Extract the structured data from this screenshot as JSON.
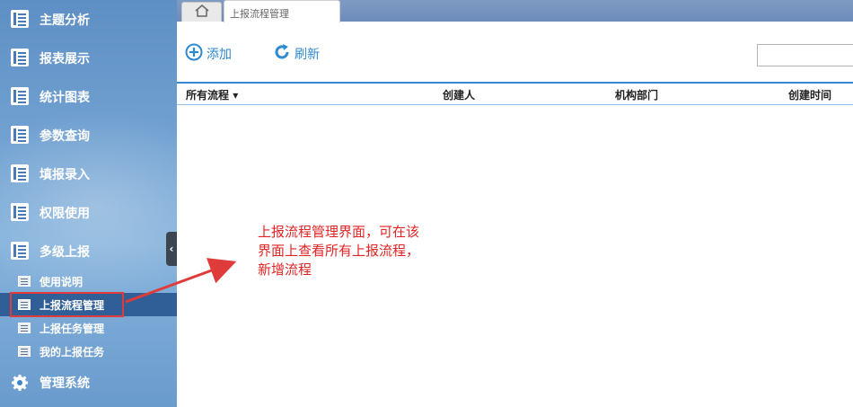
{
  "sidebar": {
    "menu": [
      {
        "label": "主题分析",
        "icon": "report-icon"
      },
      {
        "label": "报表展示",
        "icon": "report-icon"
      },
      {
        "label": "统计图表",
        "icon": "report-icon"
      },
      {
        "label": "参数查询",
        "icon": "report-icon"
      },
      {
        "label": "填报录入",
        "icon": "report-icon"
      },
      {
        "label": "权限使用",
        "icon": "report-icon"
      },
      {
        "label": "多级上报",
        "icon": "report-icon"
      }
    ],
    "submenu": [
      {
        "label": "使用说明",
        "icon": "doc-icon"
      },
      {
        "label": "上报流程管理",
        "icon": "list-icon",
        "active": true
      },
      {
        "label": "上报任务管理",
        "icon": "list-icon"
      },
      {
        "label": "我的上报任务",
        "icon": "list-icon"
      }
    ],
    "system": {
      "label": "管理系统",
      "icon": "gear-icon"
    },
    "collapse_glyph": "‹"
  },
  "tabs": {
    "home_icon": "home-icon",
    "active_tab": "上报流程管理"
  },
  "toolbar": {
    "add_label": "添加",
    "refresh_label": "刷新",
    "search_value": ""
  },
  "table": {
    "columns": [
      "所有流程",
      "创建人",
      "机构部门",
      "创建时间"
    ],
    "first_column_dropdown": "▾",
    "rows": []
  },
  "annotation": {
    "text": "上报流程管理界面，可在该界面上查看所有上报流程，新增流程",
    "color": "#e02424"
  },
  "colors": {
    "accent": "#2e8ad1",
    "sidebar_active": "#2f5f96",
    "annotation_red": "#e03b3b"
  }
}
